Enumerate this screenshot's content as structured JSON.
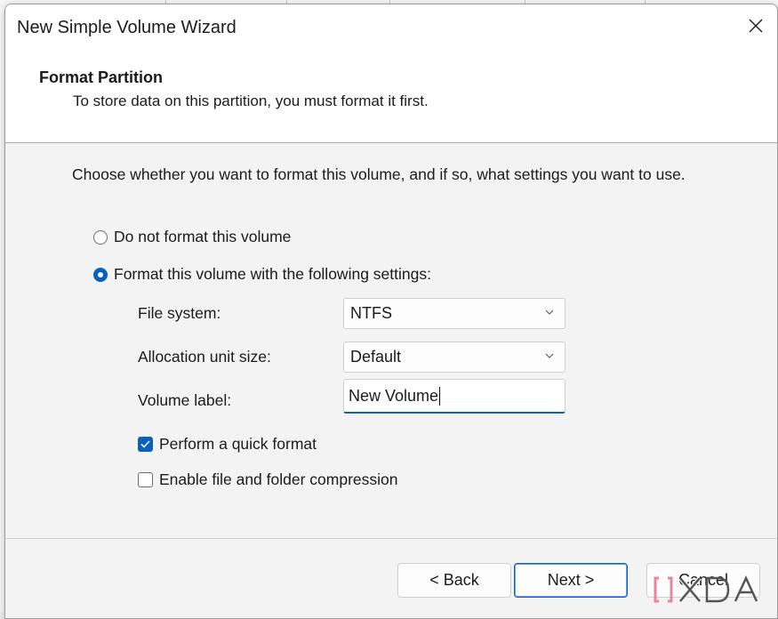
{
  "dialog": {
    "title": "New Simple Volume Wizard",
    "heading": "Format Partition",
    "subheading": "To store data on this partition, you must format it first.",
    "instruction": "Choose whether you want to format this volume, and if so, what settings you want to use."
  },
  "options": {
    "no_format": {
      "label": "Do not format this volume",
      "selected": false
    },
    "format": {
      "label": "Format this volume with the following settings:",
      "selected": true
    }
  },
  "fields": {
    "file_system": {
      "label": "File system:",
      "value": "NTFS"
    },
    "allocation_unit_size": {
      "label": "Allocation unit size:",
      "value": "Default"
    },
    "volume_label": {
      "label": "Volume label:",
      "value": "New Volume"
    }
  },
  "checkboxes": {
    "quick_format": {
      "label": "Perform a quick format",
      "checked": true
    },
    "compression": {
      "label": "Enable file and folder compression",
      "checked": false
    }
  },
  "buttons": {
    "back": "< Back",
    "next": "Next >",
    "cancel": "Cancel"
  },
  "icons": {
    "close": "close-icon",
    "chevron": "chevron-down-icon",
    "check": "checkmark-icon"
  },
  "colors": {
    "accent": "#0a5fbf",
    "watermark": "#e9869a"
  }
}
